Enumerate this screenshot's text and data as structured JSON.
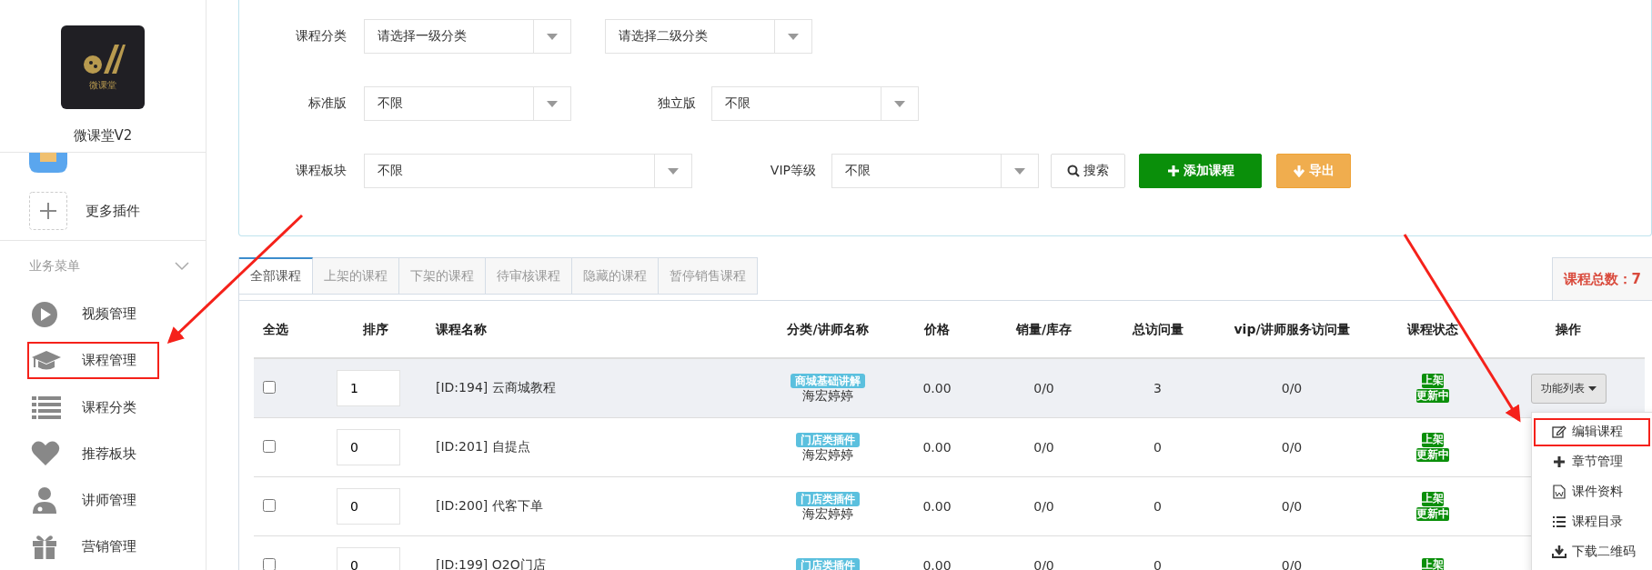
{
  "sidebar": {
    "logo": {
      "text": "微课堂"
    },
    "app_name": "微课堂V2",
    "plugins": [
      {
        "label": "更多插件"
      }
    ],
    "section": {
      "title": "业务菜单",
      "expanded": true
    },
    "items": [
      {
        "label": "视频管理",
        "annotated": false
      },
      {
        "label": "课程管理",
        "annotated": true
      },
      {
        "label": "课程分类",
        "annotated": false
      },
      {
        "label": "推荐板块",
        "annotated": false
      },
      {
        "label": "讲师管理",
        "annotated": false
      },
      {
        "label": "营销管理",
        "annotated": false
      }
    ]
  },
  "filters": [
    {
      "label": "课程分类",
      "selects": [
        "请选择一级分类",
        "请选择二级分类"
      ]
    },
    {
      "label": "标准版",
      "selects": [
        "不限"
      ]
    },
    {
      "label": "独立版",
      "selects": [
        "不限"
      ]
    },
    {
      "label": "课程板块",
      "selects": [
        "不限"
      ]
    },
    {
      "label": "VIP等级",
      "selects": [
        "不限"
      ]
    }
  ],
  "buttons": [
    {
      "label": "搜索",
      "kind": "search"
    },
    {
      "label": "添加课程",
      "kind": "add"
    },
    {
      "label": "导出",
      "kind": "export"
    }
  ],
  "tabs": [
    {
      "label": "全部课程",
      "selected": true
    },
    {
      "label": "上架的课程",
      "selected": false
    },
    {
      "label": "下架的课程",
      "selected": false
    },
    {
      "label": "待审核课程",
      "selected": false
    },
    {
      "label": "隐藏的课程",
      "selected": false
    },
    {
      "label": "暂停销售课程",
      "selected": false
    }
  ],
  "total": "课程总数：7",
  "table": {
    "columns": [
      "全选",
      "排序",
      "课程名称",
      "分类/讲师名称",
      "价格",
      "销量/库存",
      "总访问量",
      "vip/讲师服务访问量",
      "课程状态",
      "操作"
    ],
    "rows": [
      {
        "checked": false,
        "highlighted": true,
        "order": "1",
        "name": "[ID:194] 云商城教程",
        "category": "商城基础讲解",
        "teacher": "海宏婷婷",
        "price": "0.00",
        "sales": "0/0",
        "visits": "3",
        "vip_visits": "0/0",
        "status": [
          "上架",
          "更新中"
        ],
        "action": "功能列表"
      },
      {
        "checked": false,
        "highlighted": false,
        "order": "0",
        "name": "[ID:201] 自提点",
        "category": "门店类插件",
        "teacher": "海宏婷婷",
        "price": "0.00",
        "sales": "0/0",
        "visits": "0",
        "vip_visits": "0/0",
        "status": [
          "上架",
          "更新中"
        ],
        "action": ""
      },
      {
        "checked": false,
        "highlighted": false,
        "order": "0",
        "name": "[ID:200] 代客下单",
        "category": "门店类插件",
        "teacher": "海宏婷婷",
        "price": "0.00",
        "sales": "0/0",
        "visits": "0",
        "vip_visits": "0/0",
        "status": [
          "上架",
          "更新中"
        ],
        "action": ""
      },
      {
        "checked": false,
        "highlighted": false,
        "order": "0",
        "name": "[ID:199] O2O门店",
        "category": "门店类插件",
        "teacher": "",
        "price": "0.00",
        "sales": "0/0",
        "visits": "0",
        "vip_visits": "0/0",
        "status": [
          "上架"
        ],
        "action": ""
      }
    ]
  },
  "action_menu": [
    {
      "label": "编辑课程",
      "annotated": true
    },
    {
      "label": "章节管理",
      "annotated": false
    },
    {
      "label": "课件资料",
      "annotated": false
    },
    {
      "label": "课程目录",
      "annotated": false
    },
    {
      "label": "下载二维码",
      "annotated": false
    }
  ]
}
